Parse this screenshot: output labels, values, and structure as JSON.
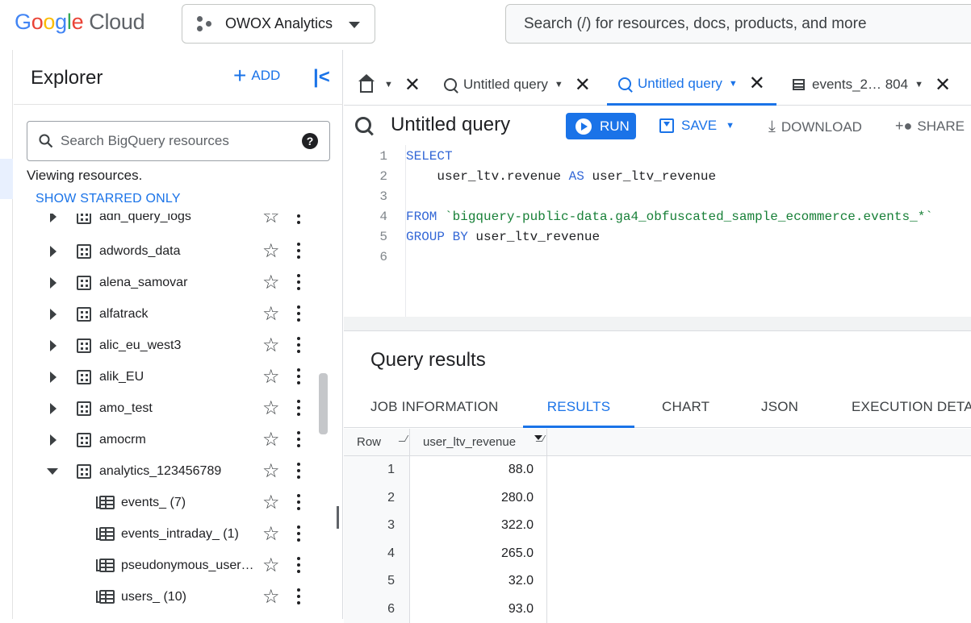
{
  "brand": {
    "logo_letters": [
      "G",
      "o",
      "o",
      "g",
      "l",
      "e"
    ],
    "cloud": "Cloud"
  },
  "project": {
    "name": "OWOX Analytics"
  },
  "search": {
    "placeholder": "Search (/) for resources, docs, products, and more"
  },
  "explorer": {
    "title": "Explorer",
    "add_label": "ADD",
    "collapse_glyph": "|<",
    "search_placeholder": "Search BigQuery resources",
    "help_glyph": "?",
    "viewing_text": "Viewing resources.",
    "starred_link": "SHOW STARRED ONLY",
    "items": [
      {
        "label": "adh_query_logs",
        "kind": "dataset",
        "state": "collapsed"
      },
      {
        "label": "adwords_data",
        "kind": "dataset",
        "state": "collapsed"
      },
      {
        "label": "alena_samovar",
        "kind": "dataset",
        "state": "collapsed"
      },
      {
        "label": "alfatrack",
        "kind": "dataset",
        "state": "collapsed"
      },
      {
        "label": "alic_eu_west3",
        "kind": "dataset",
        "state": "collapsed"
      },
      {
        "label": "alik_EU",
        "kind": "dataset",
        "state": "collapsed"
      },
      {
        "label": "amo_test",
        "kind": "dataset",
        "state": "collapsed"
      },
      {
        "label": "amocrm",
        "kind": "dataset",
        "state": "collapsed"
      },
      {
        "label": "analytics_123456789",
        "kind": "dataset",
        "state": "expanded"
      },
      {
        "label": "events_ (7)",
        "kind": "table"
      },
      {
        "label": "events_intraday_ (1)",
        "kind": "table"
      },
      {
        "label": "pseudonymous_user…",
        "kind": "table"
      },
      {
        "label": "users_ (10)",
        "kind": "table"
      }
    ]
  },
  "tabs": [
    {
      "kind": "home"
    },
    {
      "label": "Untitled query",
      "kind": "query",
      "active": false
    },
    {
      "label": "Untitled query",
      "kind": "query",
      "active": true
    },
    {
      "label": "events_2… 804",
      "kind": "table",
      "active": false
    }
  ],
  "query": {
    "title": "Untitled query",
    "run_label": "RUN",
    "save_label": "SAVE",
    "download_label": "DOWNLOAD",
    "share_label": "SHARE",
    "lines": [
      {
        "n": "1",
        "parts": [
          {
            "t": "SELECT",
            "c": "kw"
          }
        ]
      },
      {
        "n": "2",
        "parts": [
          {
            "t": "    user_ltv.revenue ",
            "c": ""
          },
          {
            "t": "AS",
            "c": "kw"
          },
          {
            "t": " user_ltv_revenue",
            "c": ""
          }
        ]
      },
      {
        "n": "3",
        "parts": []
      },
      {
        "n": "4",
        "parts": [
          {
            "t": "FROM",
            "c": "kw"
          },
          {
            "t": " `bigquery-public-data.ga4_obfuscated_sample_ecommerce.events_*`",
            "c": "str"
          }
        ]
      },
      {
        "n": "5",
        "parts": [
          {
            "t": "GROUP BY",
            "c": "kw"
          },
          {
            "t": " user_ltv_revenue",
            "c": ""
          }
        ]
      },
      {
        "n": "6",
        "parts": []
      }
    ]
  },
  "results": {
    "title": "Query results",
    "tabs": [
      "JOB INFORMATION",
      "RESULTS",
      "CHART",
      "JSON",
      "EXECUTION DETAI"
    ],
    "active_tab": 1,
    "columns": [
      "Row",
      "user_ltv_revenue"
    ],
    "rows": [
      [
        "1",
        "88.0"
      ],
      [
        "2",
        "280.0"
      ],
      [
        "3",
        "322.0"
      ],
      [
        "4",
        "265.0"
      ],
      [
        "5",
        "32.0"
      ],
      [
        "6",
        "93.0"
      ]
    ]
  },
  "colors": {
    "accent": "#1a73e8",
    "keyword": "#3367d6",
    "string": "#188038"
  }
}
